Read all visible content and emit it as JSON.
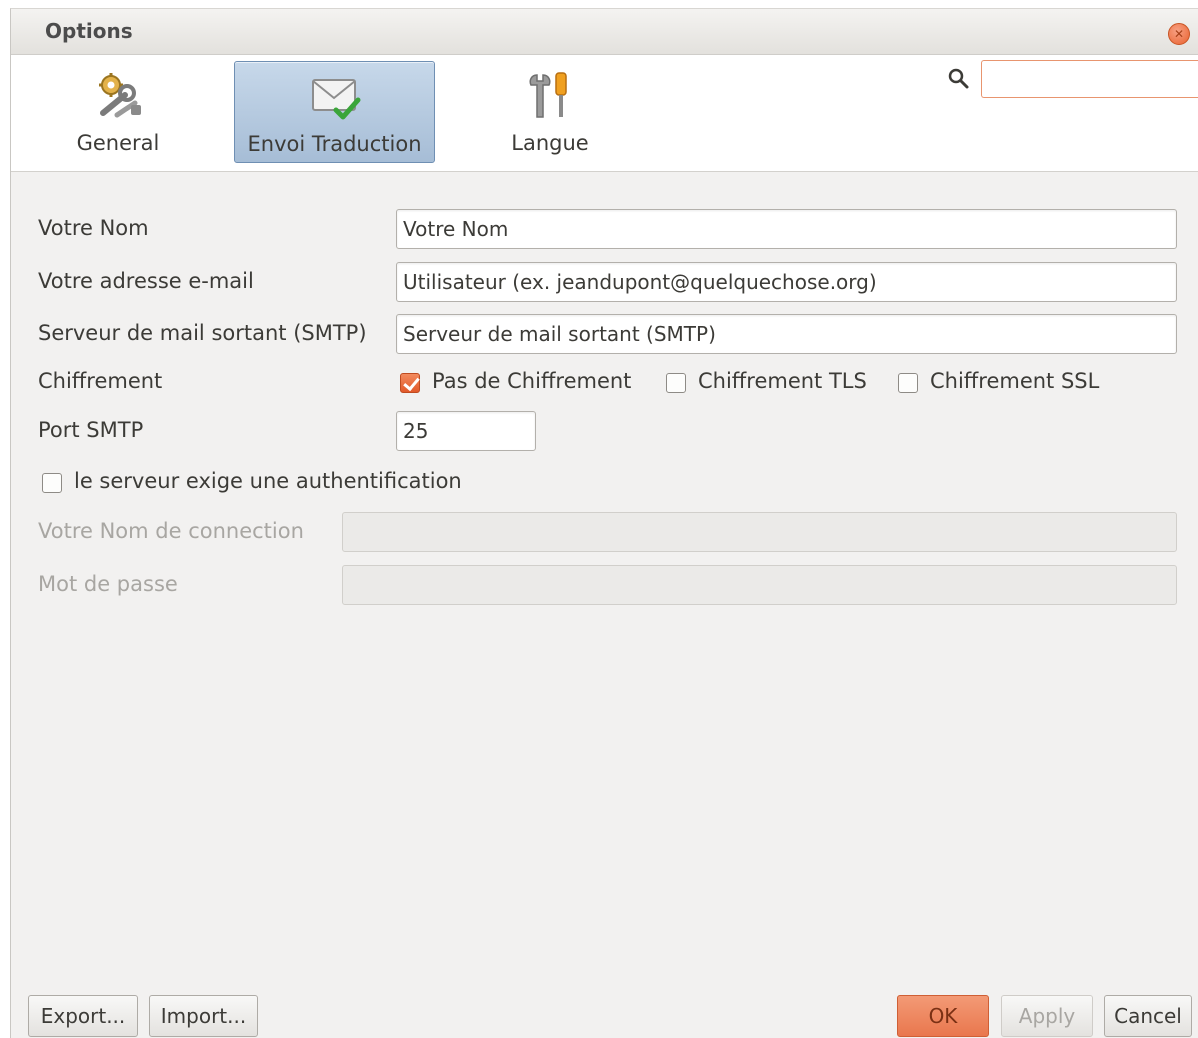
{
  "window": {
    "title": "Options"
  },
  "toolbar": {
    "tabs": [
      {
        "label": "General",
        "icon": "gear-wrench-icon",
        "selected": false
      },
      {
        "label": "Envoi Traduction",
        "icon": "mail-check-icon",
        "selected": true
      },
      {
        "label": "Langue",
        "icon": "tools-icon",
        "selected": false
      }
    ],
    "search": {
      "value": "",
      "placeholder": ""
    }
  },
  "form": {
    "name": {
      "label": "Votre Nom",
      "value": "Votre Nom"
    },
    "email": {
      "label": "Votre adresse e-mail",
      "value": "Utilisateur (ex. jeandupont@quelquechose.org)"
    },
    "smtp_server": {
      "label": "Serveur de mail sortant (SMTP)",
      "value": "Serveur de mail sortant (SMTP)"
    },
    "encryption": {
      "label": "Chiffrement",
      "options": [
        {
          "label": "Pas de Chiffrement",
          "checked": true
        },
        {
          "label": "Chiffrement TLS",
          "checked": false
        },
        {
          "label": "Chiffrement SSL",
          "checked": false
        }
      ]
    },
    "port": {
      "label": "Port SMTP",
      "value": "25"
    },
    "auth_required": {
      "label": "le serveur exige une authentification",
      "checked": false
    },
    "login": {
      "label": "Votre Nom de connection",
      "value": ""
    },
    "password": {
      "label": "Mot de passe",
      "value": ""
    }
  },
  "buttons": {
    "export": "Export...",
    "import": "Import...",
    "ok": "OK",
    "apply": "Apply",
    "cancel": "Cancel"
  },
  "colors": {
    "accent": "#e9774e",
    "selected_tab": "#b5c9df",
    "window_bg": "#f2f1f0"
  }
}
